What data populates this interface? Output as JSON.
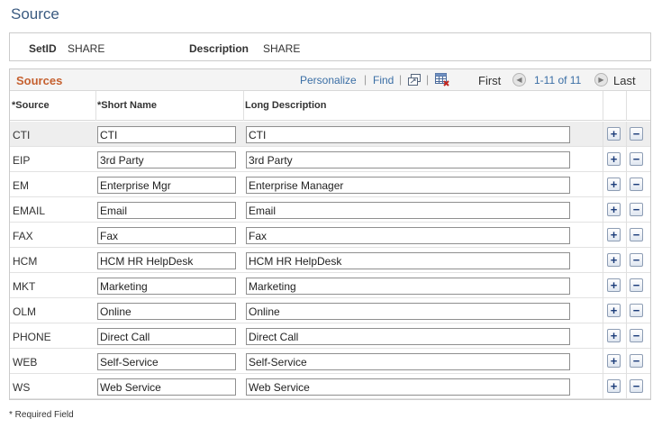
{
  "page": {
    "title": "Source"
  },
  "header": {
    "setid_label": "SetID",
    "setid_value": "SHARE",
    "description_label": "Description",
    "description_value": "SHARE"
  },
  "grid": {
    "title": "Sources",
    "personalize": "Personalize",
    "find": "Find",
    "first": "First",
    "range": "1-11 of 11",
    "last": "Last",
    "columns": {
      "source": "*Source",
      "short_name": "*Short Name",
      "long_description": "Long Description"
    },
    "add_glyph": "+",
    "delete_glyph": "−",
    "rows": [
      {
        "source": "CTI",
        "short_name": "CTI",
        "long_description": "CTI"
      },
      {
        "source": "EIP",
        "short_name": "3rd Party",
        "long_description": "3rd Party"
      },
      {
        "source": "EM",
        "short_name": "Enterprise Mgr",
        "long_description": "Enterprise Manager"
      },
      {
        "source": "EMAIL",
        "short_name": "Email",
        "long_description": "Email"
      },
      {
        "source": "FAX",
        "short_name": "Fax",
        "long_description": "Fax"
      },
      {
        "source": "HCM",
        "short_name": "HCM HR HelpDesk",
        "long_description": "HCM HR HelpDesk"
      },
      {
        "source": "MKT",
        "short_name": "Marketing",
        "long_description": "Marketing"
      },
      {
        "source": "OLM",
        "short_name": "Online",
        "long_description": "Online"
      },
      {
        "source": "PHONE",
        "short_name": "Direct Call",
        "long_description": "Direct Call"
      },
      {
        "source": "WEB",
        "short_name": "Self-Service",
        "long_description": "Self-Service"
      },
      {
        "source": "WS",
        "short_name": "Web Service",
        "long_description": "Web Service"
      }
    ]
  },
  "footer": {
    "required_note": "* Required Field"
  },
  "colors": {
    "title": "#3a5a80",
    "grid_title": "#c5602f",
    "link": "#3a6ea5"
  },
  "icons": [
    "view-all-icon",
    "download-grid-icon",
    "prev-arrow-icon",
    "next-arrow-icon",
    "add-row-icon",
    "delete-row-icon"
  ]
}
